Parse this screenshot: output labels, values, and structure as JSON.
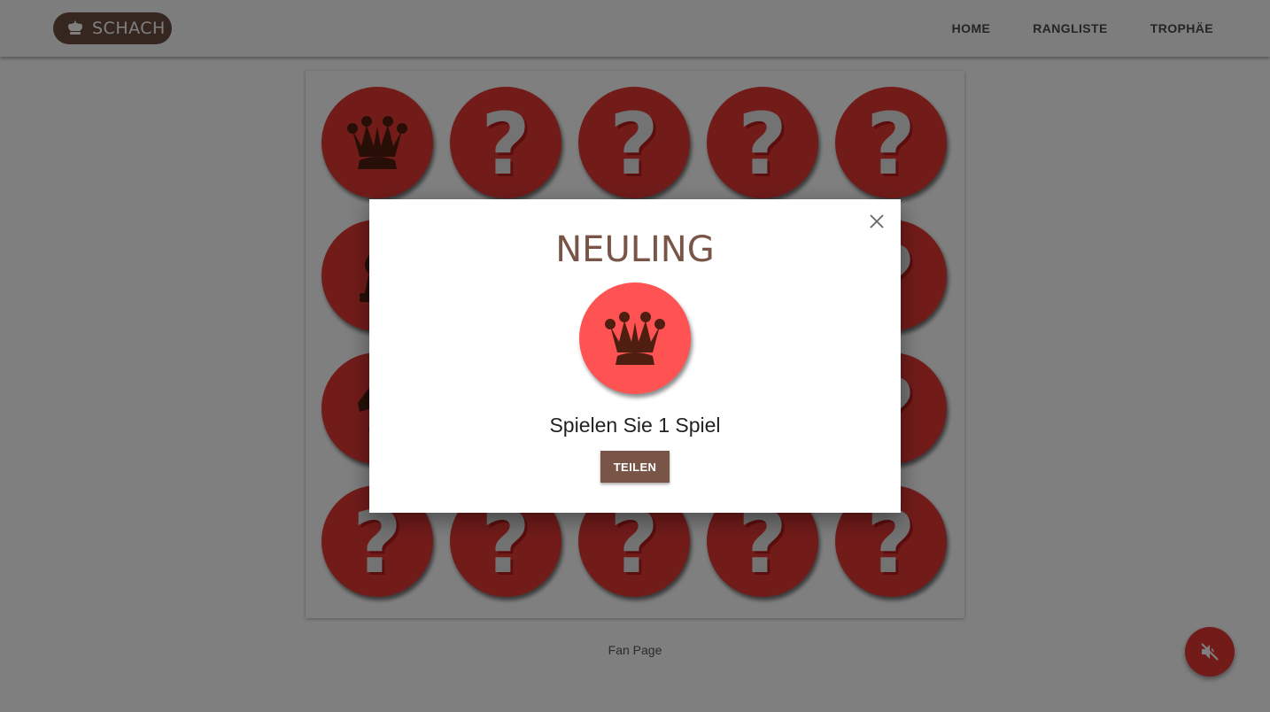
{
  "header": {
    "logo_text": "SCHACH",
    "nav": [
      {
        "label": "HOME"
      },
      {
        "label": "RANGLISTE"
      },
      {
        "label": "TROPHÄE"
      }
    ]
  },
  "board": {
    "tiles": [
      "queen",
      "?",
      "?",
      "?",
      "?",
      "pawn",
      "?",
      "?",
      "?",
      "?",
      "knight",
      "?",
      "?",
      "?",
      "?",
      "?",
      "?",
      "?",
      "?",
      "?"
    ]
  },
  "footer": {
    "link": "Fan Page"
  },
  "fab": {
    "icon": "volume-off-icon"
  },
  "modal": {
    "title": "NEULING",
    "trophy_icon": "queen-icon",
    "description": "Spielen Sie 1 Spiel",
    "share_label": "TEILEN",
    "close_icon": "close-icon"
  },
  "colors": {
    "brand_brown": "#795548",
    "coin_red": "#e53935",
    "trophy_red": "#ff5252",
    "piece_dark": "#4e1e10"
  }
}
